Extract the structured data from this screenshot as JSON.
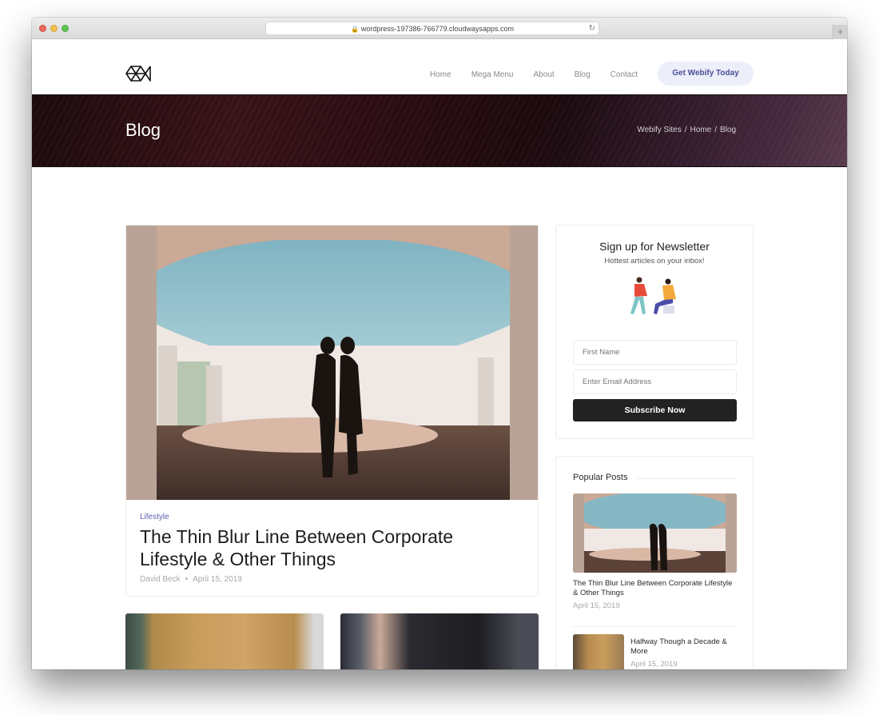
{
  "browser": {
    "url": "wordpress-197386-766779.cloudwaysapps.com",
    "lock_icon": "lock-icon",
    "reload_icon": "reload-icon",
    "new_tab_icon": "plus-icon",
    "new_tab_glyph": "+"
  },
  "header": {
    "logo_icon": "webify-logo-icon",
    "nav": [
      {
        "label": "Home"
      },
      {
        "label": "Mega Menu"
      },
      {
        "label": "About"
      },
      {
        "label": "Blog"
      },
      {
        "label": "Contact"
      }
    ],
    "cta_label": "Get Webify Today",
    "cta_bg": "#eceefa",
    "cta_color": "#4b4f96"
  },
  "hero": {
    "title": "Blog",
    "breadcrumb": [
      "Webify Sites",
      "Home",
      "Blog"
    ],
    "separator": "/"
  },
  "featured_post": {
    "image": "couple-silhouette-photo",
    "category": "Lifestyle",
    "title": "The Thin Blur Line Between Corporate Lifestyle & Other Things",
    "author": "David Beck",
    "meta_separator": "•",
    "date": "April 15, 2019",
    "category_color": "#5a5fa8"
  },
  "more_posts": [
    {
      "image": "mustard-sweater-photo"
    },
    {
      "image": "meeting-hands-photo"
    }
  ],
  "newsletter": {
    "title": "Sign up for Newsletter",
    "subtitle": "Hottest articles on your inbox!",
    "illustration": "two-people-illustration",
    "first_name_placeholder": "First Name",
    "email_placeholder": "Enter Email Address",
    "button_label": "Subscribe Now"
  },
  "popular_posts": {
    "heading": "Popular Posts",
    "items": [
      {
        "title": "The Thin Blur Line Between Corporate Lifestyle & Other Things",
        "date": "April 15, 2019",
        "image": "couple-silhouette-photo"
      },
      {
        "title": "Halfway Though a Decade & More",
        "date": "April 15, 2019",
        "image": "mustard-sweater-photo"
      }
    ]
  }
}
